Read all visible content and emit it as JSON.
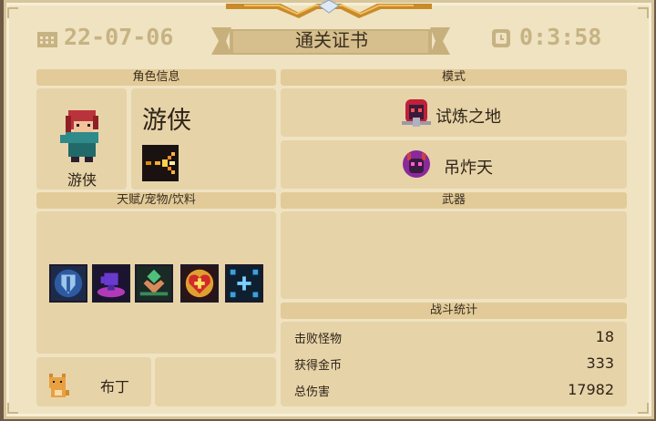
{
  "header": {
    "date": "22-07-06",
    "time": "0:3:58",
    "title": "通关证书"
  },
  "sections": {
    "character_info": "角色信息",
    "mode": "模式",
    "talents_pets_drinks": "天赋/宠物/饮料",
    "weapons": "武器",
    "battle_stats": "战斗统计"
  },
  "character": {
    "name": "游侠",
    "portrait_label": "游侠",
    "portrait_icon": "ranger-portrait-icon",
    "skill_icon": "ranger-skill-icon"
  },
  "modes": [
    {
      "label": "试炼之地",
      "icon": "trial-land-icon"
    },
    {
      "label": "吊炸天",
      "icon": "badass-mode-icon"
    }
  ],
  "talents": [
    {
      "icon": "shield-talent-icon"
    },
    {
      "icon": "purple-hand-talent-icon"
    },
    {
      "icon": "green-heart-talent-icon"
    },
    {
      "icon": "red-heart-talent-icon"
    },
    {
      "icon": "sparkle-talent-icon"
    }
  ],
  "pet": {
    "name": "布丁",
    "icon": "cat-pet-icon"
  },
  "stats": [
    {
      "label": "击败怪物",
      "value": "18"
    },
    {
      "label": "获得金币",
      "value": "333"
    },
    {
      "label": "总伤害",
      "value": "17982"
    }
  ],
  "colors": {
    "parchment": "#efe3c2",
    "panel": "#e7d3a8",
    "header_text": "#c7b282",
    "banner": "#c8b07c"
  }
}
